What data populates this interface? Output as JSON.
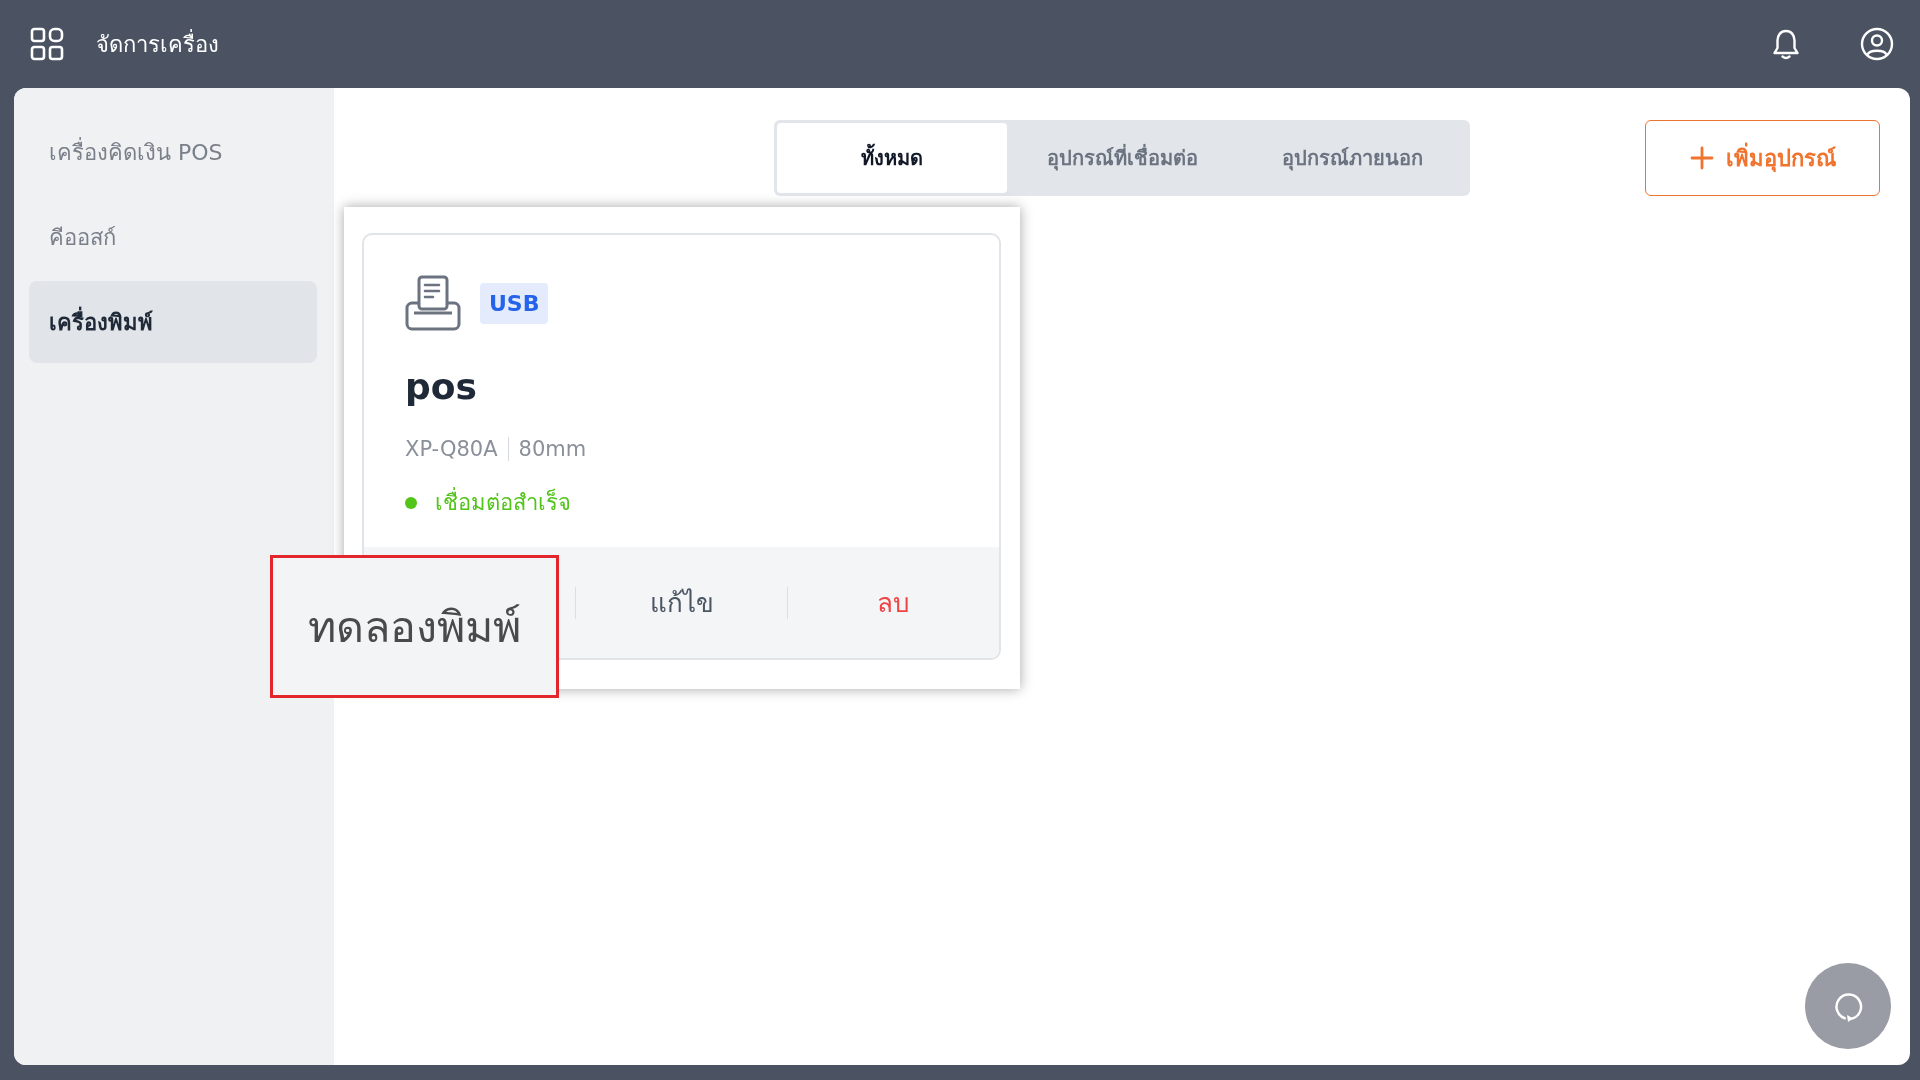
{
  "top_bar": {
    "title": "จัดการเครื่อง"
  },
  "sidebar": {
    "items": [
      {
        "label": "เครื่องคิดเงิน POS",
        "selected": false
      },
      {
        "label": "คีออสก์",
        "selected": false
      },
      {
        "label": "เครื่องพิมพ์",
        "selected": true
      }
    ]
  },
  "tabs": [
    {
      "label": "ทั้งหมด",
      "selected": true
    },
    {
      "label": "อุปกรณ์ที่เชื่อมต่อ",
      "selected": false
    },
    {
      "label": "อุปกรณ์ภายนอก",
      "selected": false
    }
  ],
  "add_button": {
    "label": "เพิ่มอุปกรณ์"
  },
  "devices": [
    {
      "connection": "USB",
      "name": "pos",
      "model": "XP-Q80A",
      "paper_width": "80mm",
      "status": {
        "label": "เชื่อมต่อสำเร็จ",
        "connected": true
      },
      "actions": [
        {
          "label": "แก้ไข",
          "kind": "edit"
        },
        {
          "label": "ลบ",
          "kind": "delete"
        }
      ]
    }
  ],
  "callout": {
    "label": "ทดลองพิมพ์"
  }
}
